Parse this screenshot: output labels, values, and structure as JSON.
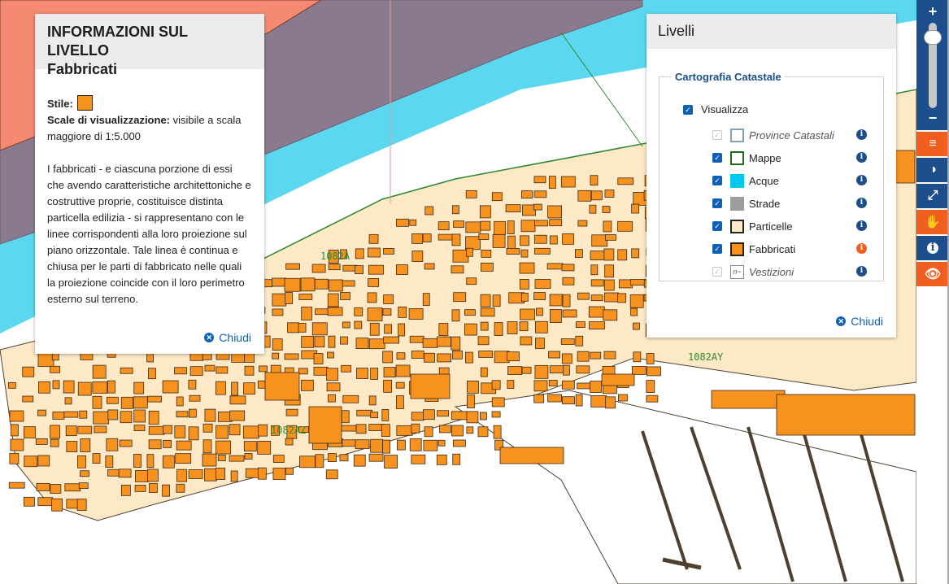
{
  "map": {
    "parcel_labels": [
      "1082A",
      "1082AZ",
      "1082AY"
    ],
    "colors": {
      "water": "#5cd7f0",
      "land": "#fde9c5",
      "buildings": "#f7921e",
      "roads": "#8a7a8d",
      "province": "#f58a72",
      "parcel_line": "#4f3f2f",
      "sheet_border": "#2f8a2f"
    }
  },
  "info_panel": {
    "title_line1": "INFORMAZIONI SUL LIVELLO",
    "title_line2": "Fabbricati",
    "style_label": "Stile:",
    "scale_label": "Scale di visualizzazione:",
    "scale_value": "visibile a scala maggiore di 1:5.000",
    "description": "I fabbricati - e ciascuna porzione di essi che avendo caratteristiche architettoniche e costruttive proprie, costituisce distinta particella edilizia - si rappresentano con le linee corrispondenti alla loro proiezione sul piano orizzontale. Tale linea è continua e chiusa per le parti di fabbricato nelle quali la proiezione coincide con il loro perimetro esterno sul terreno.",
    "close_label": "Chiudi"
  },
  "layers_panel": {
    "title": "Livelli",
    "group_title": "Cartografia Catastale",
    "visualizza_label": "Visualizza",
    "visualizza_checked": true,
    "layers": [
      {
        "label": "Province Catastali",
        "checked": true,
        "disabled": true,
        "italic": true,
        "swatch": "province",
        "info_active": false
      },
      {
        "label": "Mappe",
        "checked": true,
        "disabled": false,
        "italic": false,
        "swatch": "mappe",
        "info_active": false
      },
      {
        "label": "Acque",
        "checked": true,
        "disabled": false,
        "italic": false,
        "swatch": "acque",
        "info_active": false
      },
      {
        "label": "Strade",
        "checked": true,
        "disabled": false,
        "italic": false,
        "swatch": "strade",
        "info_active": false
      },
      {
        "label": "Particelle",
        "checked": true,
        "disabled": false,
        "italic": false,
        "swatch": "particelle",
        "info_active": false
      },
      {
        "label": "Fabbricati",
        "checked": true,
        "disabled": false,
        "italic": false,
        "swatch": "fabbricati",
        "info_active": true
      },
      {
        "label": "Vestizioni",
        "checked": true,
        "disabled": true,
        "italic": true,
        "swatch": "vestizioni",
        "info_active": false
      }
    ],
    "vestizioni_swatch_text": "n~",
    "close_label": "Chiudi",
    "info_glyph": "i",
    "check_glyph": "✓"
  },
  "toolbar": {
    "zoom_in": "+",
    "zoom_out": "−",
    "zoom_level": 0.9,
    "tools": [
      {
        "name": "layers-menu-button",
        "icon": "menu-icon",
        "glyph": "≡",
        "color": "#f05f1f"
      },
      {
        "name": "contrast-button",
        "icon": "contrast-icon",
        "glyph": "◑",
        "color": "#1c4e8c"
      },
      {
        "name": "fullscreen-button",
        "icon": "expand-icon",
        "glyph": "⤢",
        "color": "#1c4e8c"
      },
      {
        "name": "pan-button",
        "icon": "hand-icon",
        "glyph": "✋",
        "color": "#f05f1f"
      },
      {
        "name": "info-button",
        "icon": "info-icon",
        "glyph": "i",
        "color": "#1c4e8c"
      },
      {
        "name": "visibility-button",
        "icon": "eye-icon",
        "glyph": "👁",
        "color": "#f05f1f"
      }
    ]
  }
}
